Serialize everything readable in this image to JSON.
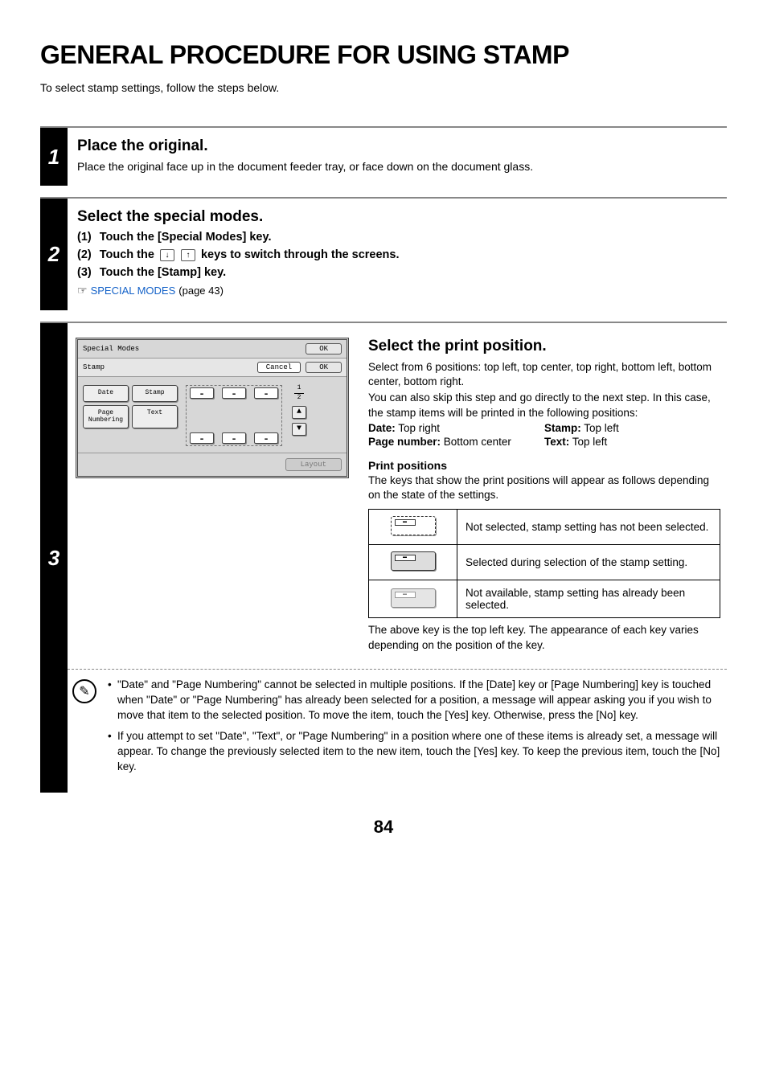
{
  "title": "GENERAL PROCEDURE FOR USING STAMP",
  "intro": "To select stamp settings, follow the steps below.",
  "step1": {
    "num": "1",
    "heading": "Place the original.",
    "text": "Place the original face up in the document feeder tray, or face down on the document glass."
  },
  "step2": {
    "num": "2",
    "heading": "Select the special modes.",
    "s1": "Touch the [Special Modes] key.",
    "s2a": "Touch the",
    "s2b": "keys to switch through the screens.",
    "s3": "Touch the [Stamp] key.",
    "link": "SPECIAL MODES",
    "link_ref": "(page 43)"
  },
  "step3": {
    "num": "3",
    "screen": {
      "title": "Special Modes",
      "ok": "OK",
      "sub": "Stamp",
      "cancel": "Cancel",
      "ok2": "OK",
      "btn_date": "Date",
      "btn_stamp": "Stamp",
      "btn_page": "Page\nNumbering",
      "btn_text": "Text",
      "page_a": "1",
      "page_b": "2",
      "layout": "Layout"
    },
    "heading": "Select the print position.",
    "para1": "Select from 6 positions: top left, top center, top right, bottom left, bottom center, bottom right.",
    "para2": "You can also skip this step and go directly to the next step. In this case, the stamp items will be printed in the following positions:",
    "defaults": {
      "date_l": "Date:",
      "date_v": "Top right",
      "stamp_l": "Stamp:",
      "stamp_v": "Top left",
      "page_l": "Page number:",
      "page_v": "Bottom center",
      "text_l": "Text:",
      "text_v": "Top left"
    },
    "pp_heading": "Print positions",
    "pp_text": "The keys that show the print positions will appear as follows depending on the state of the settings.",
    "tbl": {
      "r1": "Not selected, stamp setting has not been selected.",
      "r2": "Selected during selection of the stamp setting.",
      "r3": "Not available, stamp setting has already been selected."
    },
    "postnote": "The above key is the top left key. The appearance of each key varies depending on the position of the key.",
    "note1": "\"Date\" and \"Page Numbering\" cannot be selected in multiple positions. If the [Date] key or [Page Numbering] key is touched when \"Date\" or \"Page Numbering\" has already been selected for a position, a message will appear asking you if you wish to move that item to the selected position. To move the item, touch the [Yes] key. Otherwise, press the [No] key.",
    "note2": "If you attempt to set \"Date\", \"Text\", or \"Page Numbering\" in a position where one of these items is already set, a message will appear. To change the previously selected item to the new item, touch the [Yes] key. To keep the previous item, touch the [No] key."
  },
  "page_number": "84"
}
